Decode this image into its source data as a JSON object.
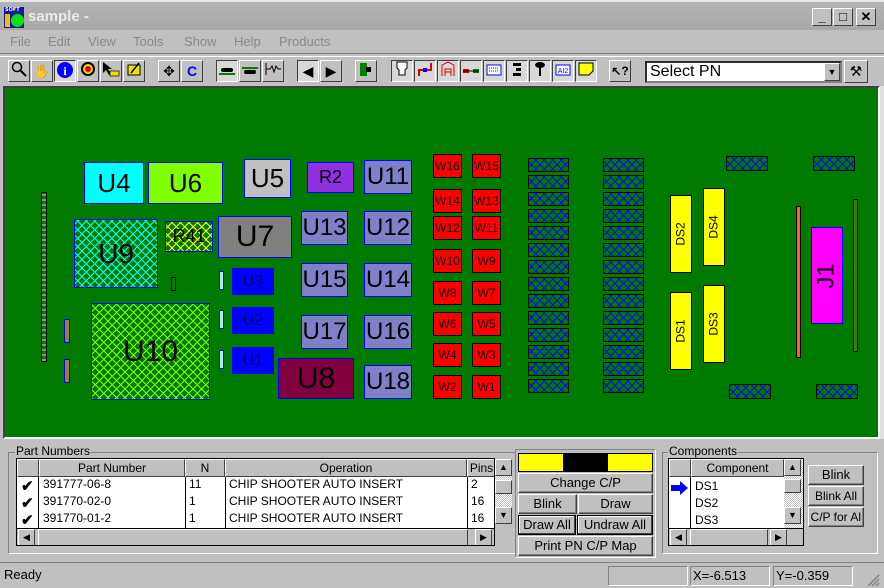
{
  "window": {
    "title": "sample -",
    "controls": {
      "minimize": "_",
      "maximize": "□",
      "close": "✕"
    }
  },
  "menu": [
    "File",
    "Edit",
    "View",
    "Tools",
    "Show",
    "Help",
    "Products"
  ],
  "toolbar": {
    "buttons": [
      {
        "name": "zoom-icon",
        "glyph": "🔍"
      },
      {
        "name": "hand-pan-icon",
        "glyph": "✋"
      },
      {
        "name": "info-icon",
        "glyph": "i"
      },
      {
        "name": "target-icon",
        "glyph": "◉"
      },
      {
        "name": "pointer-measure-icon",
        "glyph": "↖"
      },
      {
        "name": "edit-note-icon",
        "glyph": "✎"
      },
      {
        "name": "move-icon",
        "glyph": "✥"
      },
      {
        "name": "rotate-icon",
        "glyph": "C"
      },
      {
        "name": "board-top-icon",
        "glyph": "▬"
      },
      {
        "name": "board-bottom-icon",
        "glyph": "▬"
      },
      {
        "name": "schematic-icon",
        "glyph": "⌇"
      },
      {
        "name": "arrow-left-icon",
        "glyph": "◀"
      },
      {
        "name": "arrow-right-icon",
        "glyph": "▶"
      },
      {
        "name": "flag-icon",
        "glyph": "▮"
      },
      {
        "name": "nozzle-icon",
        "glyph": "⊓"
      },
      {
        "name": "route-icon",
        "glyph": "┘"
      },
      {
        "name": "outline-icon",
        "glyph": "A"
      },
      {
        "name": "component-line-icon",
        "glyph": "═"
      },
      {
        "name": "grid-icon",
        "glyph": "▦"
      },
      {
        "name": "align-icon",
        "glyph": "≡"
      },
      {
        "name": "pin-icon",
        "glyph": "T"
      },
      {
        "name": "label-icon",
        "glyph": "AI"
      },
      {
        "name": "sticky-note-icon",
        "glyph": "▭"
      },
      {
        "name": "context-help-icon",
        "glyph": "↖?"
      }
    ],
    "select_pn": "Select PN",
    "hammer": "⚒"
  },
  "board": {
    "components": [
      {
        "ref": "U4"
      },
      {
        "ref": "U6"
      },
      {
        "ref": "U5"
      },
      {
        "ref": "R2"
      },
      {
        "ref": "U11"
      },
      {
        "ref": "U9"
      },
      {
        "ref": "R41"
      },
      {
        "ref": "U7"
      },
      {
        "ref": "U13"
      },
      {
        "ref": "U12"
      },
      {
        "ref": "U3"
      },
      {
        "ref": "U15"
      },
      {
        "ref": "U14"
      },
      {
        "ref": "U2"
      },
      {
        "ref": "U10"
      },
      {
        "ref": "U17"
      },
      {
        "ref": "U16"
      },
      {
        "ref": "U1"
      },
      {
        "ref": "U8"
      },
      {
        "ref": "U18"
      },
      {
        "ref": "DS2"
      },
      {
        "ref": "DS4"
      },
      {
        "ref": "DS1"
      },
      {
        "ref": "DS3"
      },
      {
        "ref": "J1"
      }
    ],
    "wires": [
      "W16",
      "W15",
      "W14",
      "W13",
      "W12",
      "W11",
      "W10",
      "W9",
      "W8",
      "W7",
      "W6",
      "W5",
      "W4",
      "W3",
      "W2",
      "W1"
    ]
  },
  "part_numbers": {
    "group_label": "Part Numbers",
    "columns": [
      "",
      "Part Number",
      "N",
      "Operation",
      "Pins"
    ],
    "rows": [
      {
        "check": "✔",
        "part_number": "391777-06-8",
        "n": "11",
        "operation": "CHIP SHOOTER AUTO INSERT",
        "pins": "2"
      },
      {
        "check": "✔",
        "part_number": "391770-02-0",
        "n": "1",
        "operation": "CHIP SHOOTER AUTO INSERT",
        "pins": "16"
      },
      {
        "check": "✔",
        "part_number": "391770-01-2",
        "n": "1",
        "operation": "CHIP SHOOTER AUTO INSERT",
        "pins": "16"
      }
    ]
  },
  "cp_panel": {
    "colors": [
      "#ffff00",
      "#000000",
      "#ffff00"
    ],
    "change_cp": "Change C/P",
    "blink": "Blink",
    "draw": "Draw",
    "draw_all": "Draw All",
    "undraw_all": "Undraw All",
    "print_map": "Print PN C/P Map"
  },
  "components_panel": {
    "group_label": "Components",
    "column": "Component",
    "rows": [
      "DS1",
      "DS2",
      "DS3"
    ],
    "blink": "Blink",
    "blink_all": "Blink All",
    "cp_for_all": "C/P for Al"
  },
  "status": {
    "text": "Ready",
    "x": "X=-6.513",
    "y": "Y=-0.359"
  }
}
